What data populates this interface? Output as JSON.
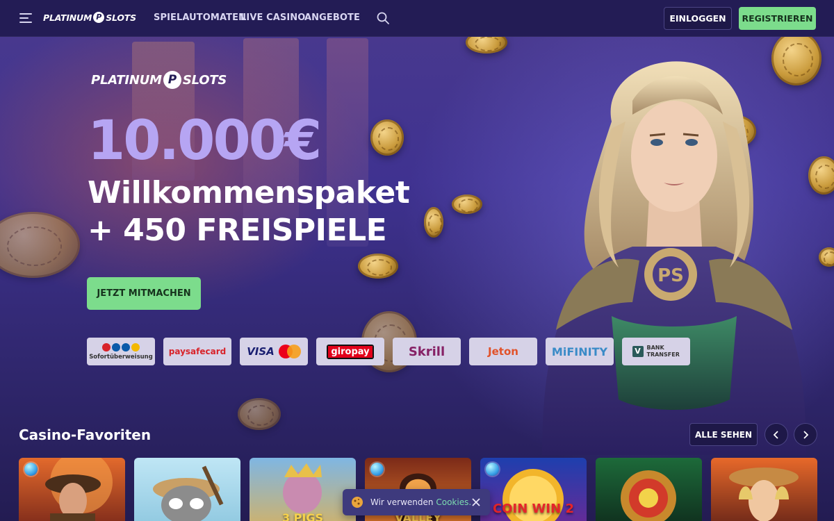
{
  "brand": {
    "name_left": "PLATINUM",
    "name_right": "SLOTS"
  },
  "nav": {
    "links": [
      "SPIELAUTOMATEN",
      "LIVE CASINO",
      "ANGEBOTE"
    ],
    "login_label": "EINLOGGEN",
    "register_label": "REGISTRIEREN"
  },
  "hero": {
    "amount": "10.000€",
    "line1": "Willkommenspaket",
    "line2": "+ 450 FREISPIELE",
    "cta_label": "JETZT MITMACHEN"
  },
  "payments": [
    {
      "name": "Sofortüberweisung"
    },
    {
      "name": "paysafecard"
    },
    {
      "name": "VISA",
      "extra": "MasterCard"
    },
    {
      "name": "giropay"
    },
    {
      "name": "Skrill"
    },
    {
      "name": "Jeton"
    },
    {
      "name": "MiFINITY"
    },
    {
      "name": "BANK TRANSFER"
    }
  ],
  "favorites": {
    "title": "Casino-Favoriten",
    "see_all_label": "ALLE SEHEN",
    "games": [
      {
        "caption": ""
      },
      {
        "caption": ""
      },
      {
        "caption": "3 PIGS"
      },
      {
        "caption": "VALLEY"
      },
      {
        "caption": "COIN WIN 2"
      },
      {
        "caption": ""
      },
      {
        "caption": ""
      }
    ]
  },
  "cookie": {
    "text": "Wir verwenden",
    "link": "Cookies."
  },
  "colors": {
    "accent_green": "#7cdc8c",
    "amount_purple": "#b6a5f3",
    "topbar": "#231c55"
  }
}
